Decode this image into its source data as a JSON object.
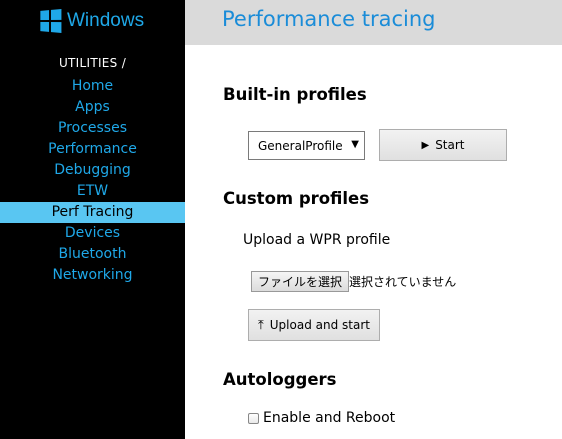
{
  "brand": {
    "name": "Windows",
    "color": "#1fa8e8"
  },
  "sidebar": {
    "section_label": "UTILITIES /",
    "items": [
      {
        "label": "Home",
        "active": false
      },
      {
        "label": "Apps",
        "active": false
      },
      {
        "label": "Processes",
        "active": false
      },
      {
        "label": "Performance",
        "active": false
      },
      {
        "label": "Debugging",
        "active": false
      },
      {
        "label": "ETW",
        "active": false
      },
      {
        "label": "Perf Tracing",
        "active": true
      },
      {
        "label": "Devices",
        "active": false
      },
      {
        "label": "Bluetooth",
        "active": false
      },
      {
        "label": "Networking",
        "active": false
      }
    ]
  },
  "header": {
    "title": "Performance tracing"
  },
  "builtin": {
    "heading": "Built-in profiles",
    "profile_select": {
      "selected": "GeneralProfile",
      "icon": "dropdown-arrow"
    },
    "start_button": {
      "label": "Start",
      "icon": "play-icon"
    }
  },
  "custom": {
    "heading": "Custom profiles",
    "upload_label": "Upload a WPR profile",
    "file_button": "ファイルを選択",
    "file_status": "選択されていません",
    "upload_button": {
      "label": "Upload and start",
      "icon": "upload-icon"
    }
  },
  "autologgers": {
    "heading": "Autologgers",
    "checkbox_label": "Enable and Reboot",
    "checked": false
  },
  "colors": {
    "accent": "#1fa8e8",
    "active_bg": "#59c6f2",
    "header_bg": "#dadada"
  }
}
